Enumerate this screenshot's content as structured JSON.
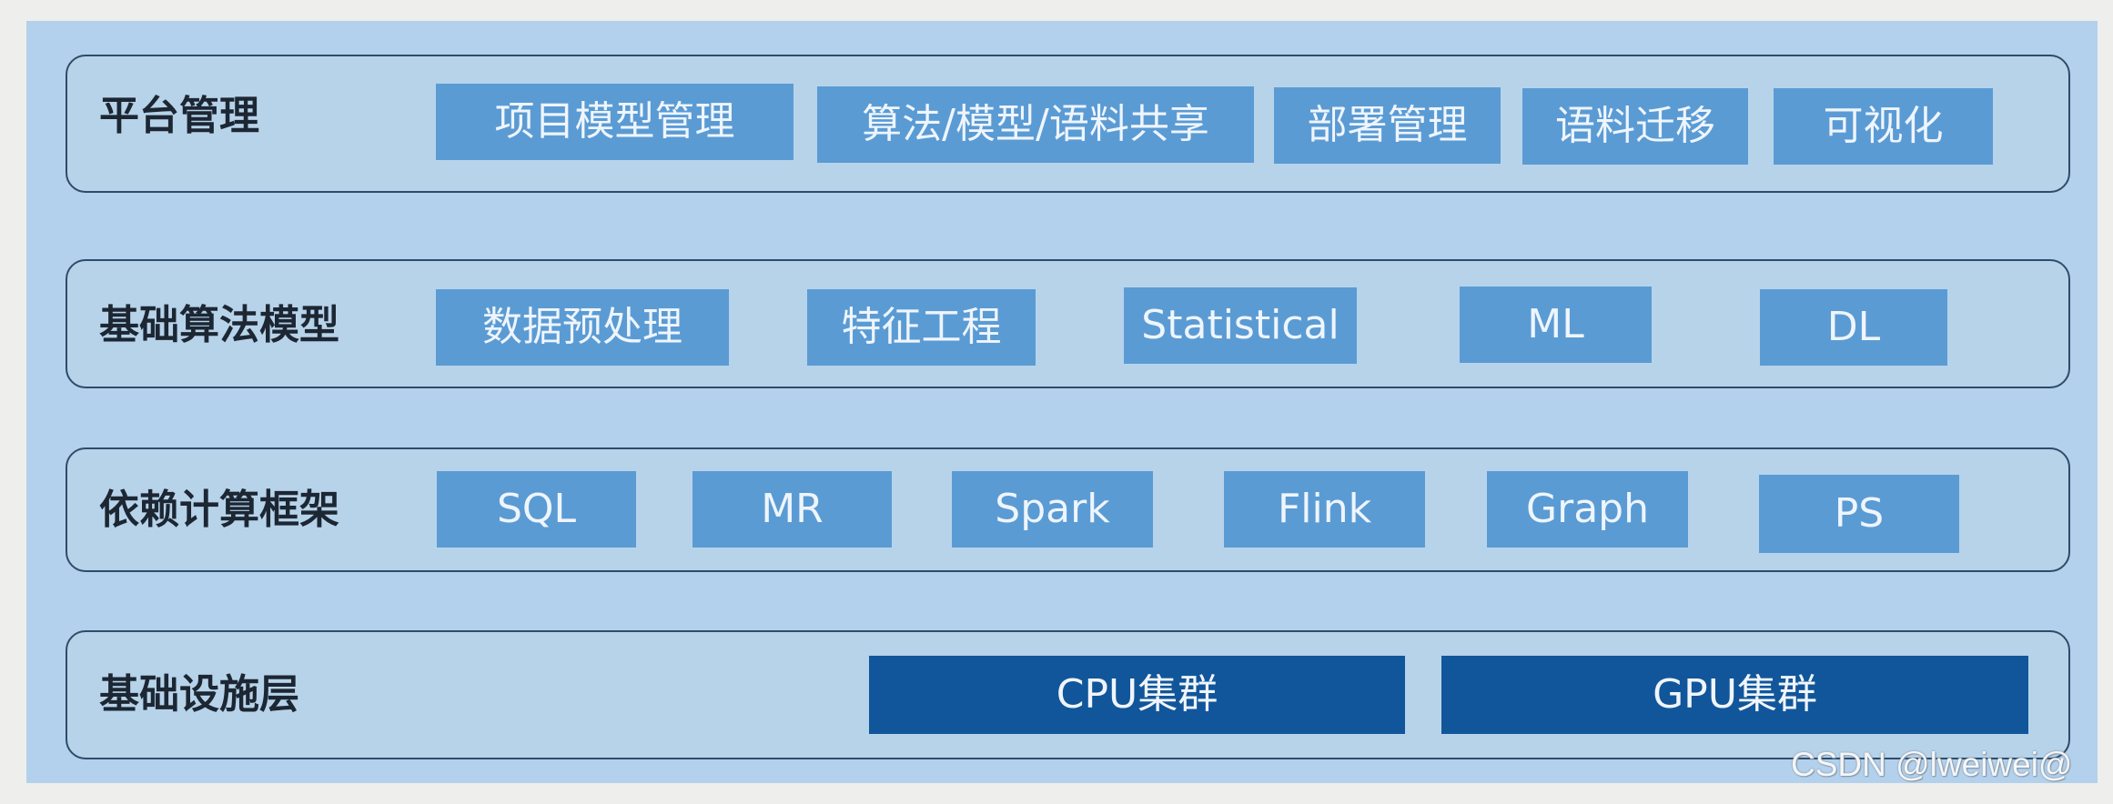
{
  "layers": [
    {
      "label": "平台管理",
      "items": [
        "项目模型管理",
        "算法/模型/语料共享",
        "部署管理",
        "语料迁移",
        "可视化"
      ]
    },
    {
      "label": "基础算法模型",
      "items": [
        "数据预处理",
        "特征工程",
        "Statistical",
        "ML",
        "DL"
      ]
    },
    {
      "label": "依赖计算框架",
      "items": [
        "SQL",
        "MR",
        "Spark",
        "Flink",
        "Graph",
        "PS"
      ]
    },
    {
      "label": "基础设施层",
      "items": [
        "CPU集群",
        "GPU集群"
      ]
    }
  ],
  "colors": {
    "panel": "#b3d1ec",
    "component_box": "#5b9bd4",
    "infra_box": "#11569a",
    "row_border": "#2e4b69"
  },
  "watermark": "CSDN @lweiwei@"
}
